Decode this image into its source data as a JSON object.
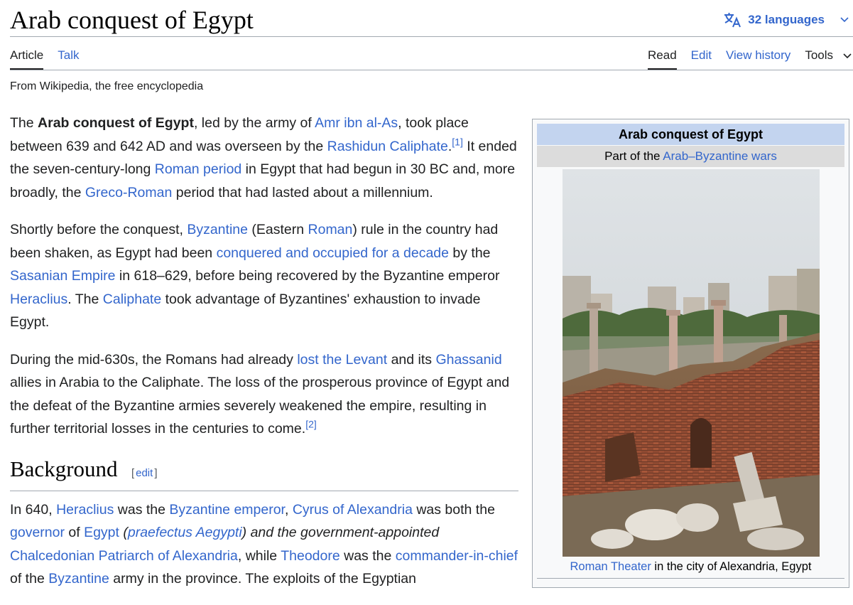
{
  "page": {
    "title": "Arab conquest of Egypt",
    "languages": "32 languages",
    "tagline": "From Wikipedia, the free encyclopedia"
  },
  "tabs": {
    "article": "Article",
    "talk": "Talk",
    "read": "Read",
    "edit": "Edit",
    "history": "View history",
    "tools": "Tools"
  },
  "paragraphs": {
    "p1": {
      "t1": "The ",
      "b1": "Arab conquest of Egypt",
      "t2": ", led by the army of ",
      "l1": "Amr ibn al-As",
      "t3": ", took place between 639 and 642 AD and was overseen by the ",
      "l2": "Rashidun Caliphate",
      "t4": ".",
      "r1": "[1]",
      "t5": " It ended the seven-century-long ",
      "l3": "Roman period",
      "t6": " in Egypt that had begun in 30 BC and, more broadly, the ",
      "l4": "Greco-Roman",
      "t7": " period that had lasted about a millennium."
    },
    "p2": {
      "t1": "Shortly before the conquest, ",
      "l1": "Byzantine",
      "t2": " (Eastern ",
      "l2": "Roman",
      "t3": ") rule in the country had been shaken, as Egypt had been ",
      "l3": "conquered and occupied for a decade",
      "t4": " by the ",
      "l4": "Sasanian Empire",
      "t5": " in 618–629, before being recovered by the Byzantine emperor ",
      "l5": "Heraclius",
      "t6": ". The ",
      "l6": "Caliphate",
      "t7": " took advantage of Byzantines' exhaustion to invade Egypt."
    },
    "p3": {
      "t1": "During the mid-630s, the Romans had already ",
      "l1": "lost the Levant",
      "t2": " and its ",
      "l2": "Ghassanid",
      "t3": " allies in Arabia to the Caliphate. The loss of the prosperous province of Egypt and the defeat of the Byzantine armies severely weakened the empire, resulting in further territorial losses in the centuries to come.",
      "r1": "[2]"
    },
    "p4": {
      "t1": "In 640, ",
      "l1": "Heraclius",
      "t2": " was the ",
      "l2": "Byzantine emperor",
      "t3": ", ",
      "l3": "Cyrus of Alexandria",
      "t4": " was both the ",
      "l4": "governor",
      "t5": " of ",
      "l5": "Egypt",
      "t6": " (",
      "l6": "praefectus Aegypti",
      "t7": ") and the government-appointed ",
      "l7": "Chalcedonian Patriarch of Alexandria",
      "t8": ", while ",
      "l8": "Theodore",
      "t9": " was the ",
      "l9": "commander-in-chief",
      "t10": " of the ",
      "l10": "Byzantine",
      "t11": " army in the province. The exploits of the Egyptian"
    }
  },
  "section": {
    "heading": "Background",
    "open_bracket": "[",
    "edit": "edit",
    "close_bracket": "]"
  },
  "infobox": {
    "title": "Arab conquest of Egypt",
    "sub_prefix": "Part of the ",
    "sub_link": "Arab–Byzantine wars",
    "caption_link": "Roman Theater",
    "caption_text": " in the city of Alexandria, Egypt"
  },
  "icons": {
    "language": "translate-icon",
    "chevron": "chevron-down-icon"
  },
  "colors": {
    "link": "#3366cc",
    "infobox_title_bg": "#c3d4ef",
    "infobox_sub_bg": "#dcdcdc",
    "rule": "#a2a9b1"
  }
}
